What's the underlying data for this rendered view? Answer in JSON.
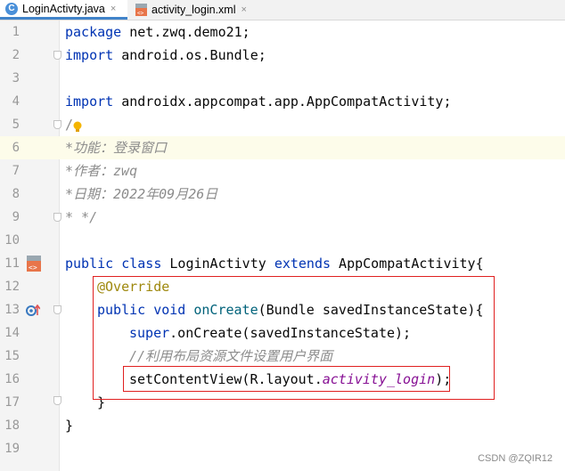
{
  "tabs": [
    {
      "label": "LoginActivty.java",
      "icon": "java-class-icon",
      "active": true
    },
    {
      "label": "activity_login.xml",
      "icon": "xml-layout-icon",
      "active": false
    }
  ],
  "close_glyph": "×",
  "line_numbers": [
    "1",
    "2",
    "3",
    "4",
    "5",
    "6",
    "7",
    "8",
    "9",
    "10",
    "11",
    "12",
    "13",
    "14",
    "15",
    "16",
    "17",
    "18",
    "19"
  ],
  "code": {
    "l1_kw": "package",
    "l1_rest": " net.zwq.demo21;",
    "l2_kw": "import",
    "l2_rest": " android.os.Bundle;",
    "l4_kw": "import",
    "l4_rest": " androidx.appcompat.app.AppCompatActivity;",
    "l5": "/",
    "l6": "*功能：登录窗口",
    "l7": "*作者：zwq",
    "l8": "*日期：2022年09月26日",
    "l9": "* */",
    "l11_kw1": "public class",
    "l11_name": " LoginActivty ",
    "l11_kw2": "extends",
    "l11_rest": " AppCompatActivity{",
    "l12": "@Override",
    "l13_kw": "public void",
    "l13_fn": " onCreate",
    "l13_rest": "(Bundle savedInstanceState){",
    "l14_kw": "super",
    "l14_rest": ".onCreate(savedInstanceState);",
    "l15": "//利用布局资源文件设置用户界面",
    "l16_pre": "setContentView(R.layout.",
    "l16_field": "activity_login",
    "l16_post": ");",
    "l17": "}",
    "l18": "}"
  },
  "watermark": "CSDN @ZQIR12",
  "colors": {
    "keyword": "#0033b3",
    "comment": "#8c8c8c",
    "annotation": "#9e880d",
    "highlight_box": "#e02020"
  }
}
